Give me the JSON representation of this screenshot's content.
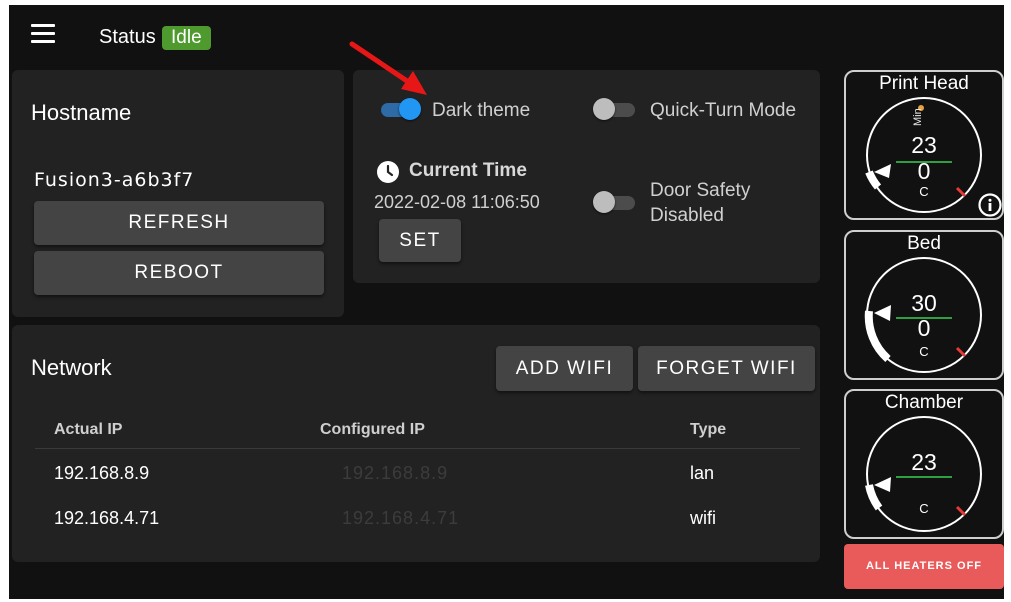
{
  "header": {
    "status_label": "Status",
    "status_value": "Idle"
  },
  "hostname_card": {
    "title": "Hostname",
    "value": "Fusion3-a6b3f7",
    "refresh_label": "REFRESH",
    "reboot_label": "REBOOT"
  },
  "settings_card": {
    "dark_theme_label": "Dark theme",
    "dark_theme_on": true,
    "quick_turn_label": "Quick-Turn Mode",
    "quick_turn_on": false,
    "current_time_label": "Current Time",
    "current_time_value": "2022-02-08 11:06:50",
    "set_label": "SET",
    "door_safety_label_1": "Door Safety",
    "door_safety_label_2": "Disabled",
    "door_safety_on": false
  },
  "network": {
    "title": "Network",
    "add_wifi_label": "ADD WIFI",
    "forget_wifi_label": "FORGET WIFI",
    "columns": [
      "Actual IP",
      "Configured IP",
      "Type"
    ],
    "rows": [
      {
        "actual": "192.168.8.9",
        "configured": "192.168.8.9",
        "type": "lan"
      },
      {
        "actual": "192.168.4.71",
        "configured": "192.168.4.71",
        "type": "wifi"
      }
    ]
  },
  "gauges": {
    "print_head": {
      "title": "Print Head",
      "actual": "23",
      "target": "0",
      "unit": "C",
      "mini_label": "Min"
    },
    "bed": {
      "title": "Bed",
      "actual": "30",
      "target": "0",
      "unit": "C"
    },
    "chamber": {
      "title": "Chamber",
      "actual": "23",
      "unit": "C"
    }
  },
  "heaters_off_label": "ALL HEATERS OFF",
  "colors": {
    "accent": "#2196f3",
    "idle": "#4f9a2e",
    "danger": "#e95a5a",
    "target_line": "#2ea043"
  }
}
